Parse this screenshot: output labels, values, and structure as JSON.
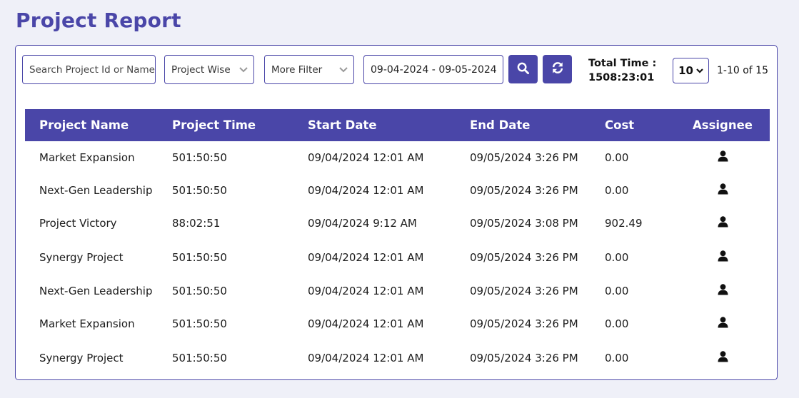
{
  "page": {
    "title": "Project Report"
  },
  "toolbar": {
    "search_placeholder": "Search Project Id or Name",
    "search_value": "",
    "project_filter": "Project Wise",
    "more_filter": "More Filter",
    "date_range": "09-04-2024 - 09-05-2024",
    "search_button_icon": "search-icon",
    "refresh_button_icon": "refresh-icon",
    "total_time_label": "Total Time :",
    "total_time_value": "1508:23:01",
    "page_size": "10",
    "page_range": "1-10 of 15"
  },
  "table": {
    "columns": [
      "Project Name",
      "Project Time",
      "Start Date",
      "End Date",
      "Cost",
      "Assignee"
    ],
    "rows": [
      {
        "name": "Market Expansion",
        "time": "501:50:50",
        "start": "09/04/2024 12:01 AM",
        "end": "09/05/2024 3:26 PM",
        "cost": "0.00",
        "assignee_icon": "user-icon"
      },
      {
        "name": "Next-Gen Leadership",
        "time": "501:50:50",
        "start": "09/04/2024 12:01 AM",
        "end": "09/05/2024 3:26 PM",
        "cost": "0.00",
        "assignee_icon": "user-icon"
      },
      {
        "name": "Project Victory",
        "time": "88:02:51",
        "start": "09/04/2024 9:12 AM",
        "end": "09/05/2024 3:08 PM",
        "cost": "902.49",
        "assignee_icon": "user-icon"
      },
      {
        "name": "Synergy Project",
        "time": "501:50:50",
        "start": "09/04/2024 12:01 AM",
        "end": "09/05/2024 3:26 PM",
        "cost": "0.00",
        "assignee_icon": "user-icon"
      },
      {
        "name": "Next-Gen Leadership",
        "time": "501:50:50",
        "start": "09/04/2024 12:01 AM",
        "end": "09/05/2024 3:26 PM",
        "cost": "0.00",
        "assignee_icon": "user-icon"
      },
      {
        "name": "Market Expansion",
        "time": "501:50:50",
        "start": "09/04/2024 12:01 AM",
        "end": "09/05/2024 3:26 PM",
        "cost": "0.00",
        "assignee_icon": "user-icon"
      },
      {
        "name": "Synergy Project",
        "time": "501:50:50",
        "start": "09/04/2024 12:01 AM",
        "end": "09/05/2024 3:26 PM",
        "cost": "0.00",
        "assignee_icon": "user-icon"
      }
    ]
  }
}
